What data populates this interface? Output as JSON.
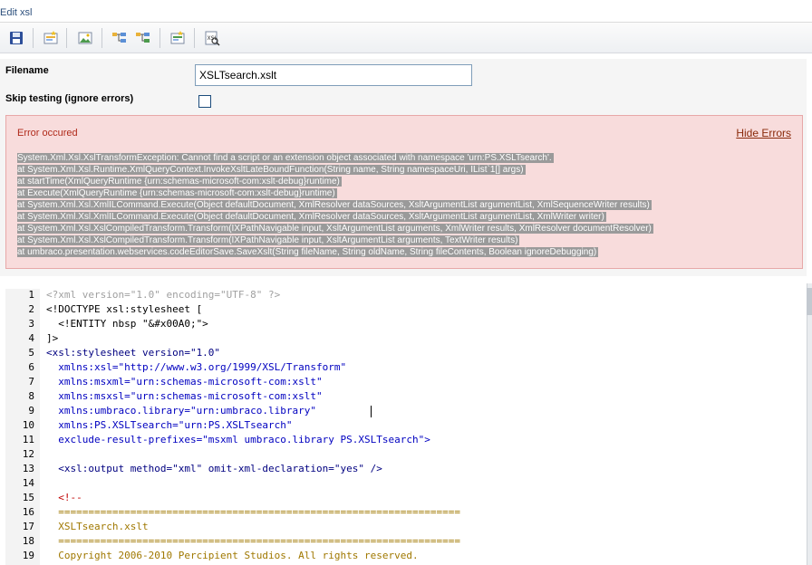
{
  "window": {
    "title": "Edit xsl"
  },
  "toolbar": {
    "buttons": [
      {
        "name": "save-icon"
      },
      {
        "name": "insert-field-icon"
      },
      {
        "name": "insert-image-icon"
      },
      {
        "name": "insert-tree-icon"
      },
      {
        "name": "insert-branch-icon"
      },
      {
        "name": "insert-value-icon"
      },
      {
        "name": "preview-icon"
      }
    ]
  },
  "form": {
    "filename_label": "Filename",
    "filename_value": "XSLTsearch.xslt",
    "skip_label": "Skip testing (ignore errors)",
    "skip_checked": false
  },
  "error": {
    "title": "Error occured",
    "hide_label": "Hide Errors",
    "lines": [
      "System.Xml.Xsl.XslTransformException: Cannot find a script or an extension object associated with namespace 'urn:PS.XSLTsearch'.",
      "at System.Xml.Xsl.Runtime.XmlQueryContext.InvokeXsltLateBoundFunction(String name, String namespaceUri, IList`1[] args)",
      "at startTime(XmlQueryRuntime {urn:schemas-microsoft-com:xslt-debug}runtime)",
      "at Execute(XmlQueryRuntime {urn:schemas-microsoft-com:xslt-debug}runtime)",
      "at System.Xml.Xsl.XmlILCommand.Execute(Object defaultDocument, XmlResolver dataSources, XsltArgumentList argumentList, XmlSequenceWriter results)",
      "at System.Xml.Xsl.XmlILCommand.Execute(Object defaultDocument, XmlResolver dataSources, XsltArgumentList argumentList, XmlWriter writer)",
      "at System.Xml.Xsl.XslCompiledTransform.Transform(IXPathNavigable input, XsltArgumentList arguments, XmlWriter results, XmlResolver documentResolver)",
      "at System.Xml.Xsl.XslCompiledTransform.Transform(IXPathNavigable input, XsltArgumentList arguments, TextWriter results)",
      "at umbraco.presentation.webservices.codeEditorSave.SaveXslt(String fileName, String oldName, String fileContents, Boolean ignoreDebugging)"
    ]
  },
  "editor": {
    "lines": [
      {
        "n": "1",
        "t": "<?xml version=\"1.0\" encoding=\"UTF-8\" ?>"
      },
      {
        "n": "2",
        "t": "<!DOCTYPE xsl:stylesheet ["
      },
      {
        "n": "3",
        "t": "  <!ENTITY nbsp \"&#x00A0;\">"
      },
      {
        "n": "4",
        "t": "]>"
      },
      {
        "n": "5",
        "t": "<xsl:stylesheet version=\"1.0\""
      },
      {
        "n": "6",
        "t": "  xmlns:xsl=\"http://www.w3.org/1999/XSL/Transform\""
      },
      {
        "n": "7",
        "t": "  xmlns:msxml=\"urn:schemas-microsoft-com:xslt\""
      },
      {
        "n": "8",
        "t": "  xmlns:msxsl=\"urn:schemas-microsoft-com:xslt\""
      },
      {
        "n": "9",
        "t": "  xmlns:umbraco.library=\"urn:umbraco.library\""
      },
      {
        "n": "10",
        "t": "  xmlns:PS.XSLTsearch=\"urn:PS.XSLTsearch\""
      },
      {
        "n": "11",
        "t": "  exclude-result-prefixes=\"msxml umbraco.library PS.XSLTsearch\">"
      },
      {
        "n": "12",
        "t": ""
      },
      {
        "n": "13",
        "t": "  <xsl:output method=\"xml\" omit-xml-declaration=\"yes\" />"
      },
      {
        "n": "14",
        "t": ""
      },
      {
        "n": "15",
        "t": "  <!--"
      },
      {
        "n": "16",
        "t": "  ==================================================================="
      },
      {
        "n": "17",
        "t": "  XSLTsearch.xslt"
      },
      {
        "n": "18",
        "t": "  ==================================================================="
      },
      {
        "n": "19",
        "t": "  Copyright 2006-2010 Percipient Studios. All rights reserved."
      }
    ]
  }
}
